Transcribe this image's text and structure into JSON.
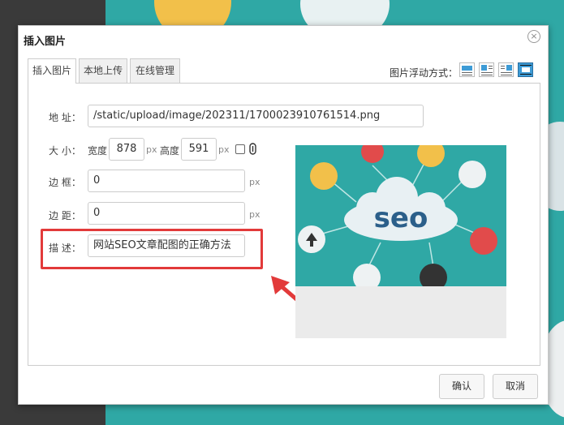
{
  "dialog": {
    "title": "插入图片",
    "close_symbol": "×",
    "tabs": [
      {
        "label": "插入图片",
        "active": true
      },
      {
        "label": "本地上传",
        "active": false
      },
      {
        "label": "在线管理",
        "active": false
      }
    ],
    "float_label": "图片浮动方式：",
    "float_options": [
      "float-none-icon",
      "float-left-icon",
      "float-right-icon",
      "float-center-icon"
    ],
    "selected_float": "float-center-icon"
  },
  "form": {
    "address_label": "地 址：",
    "address_value": "/static/upload/image/202311/1700023910761514.png",
    "size_label": "大 小：",
    "width_label": "宽度",
    "width_value": "878",
    "width_unit": "px",
    "height_label": "高度",
    "height_value": "591",
    "border_label": "边 框：",
    "border_value": "0",
    "border_unit": "px",
    "margin_label": "边 距：",
    "margin_value": "0",
    "margin_unit": "px",
    "desc_label": "描 述：",
    "desc_value": "网站SEO文章配图的正确方法"
  },
  "preview": {
    "center_text": "seo",
    "background_color": "#2fa8a5"
  },
  "buttons": {
    "ok_label": "确认",
    "cancel_label": "取消"
  },
  "annotation": {
    "color": "#e23a3a"
  }
}
